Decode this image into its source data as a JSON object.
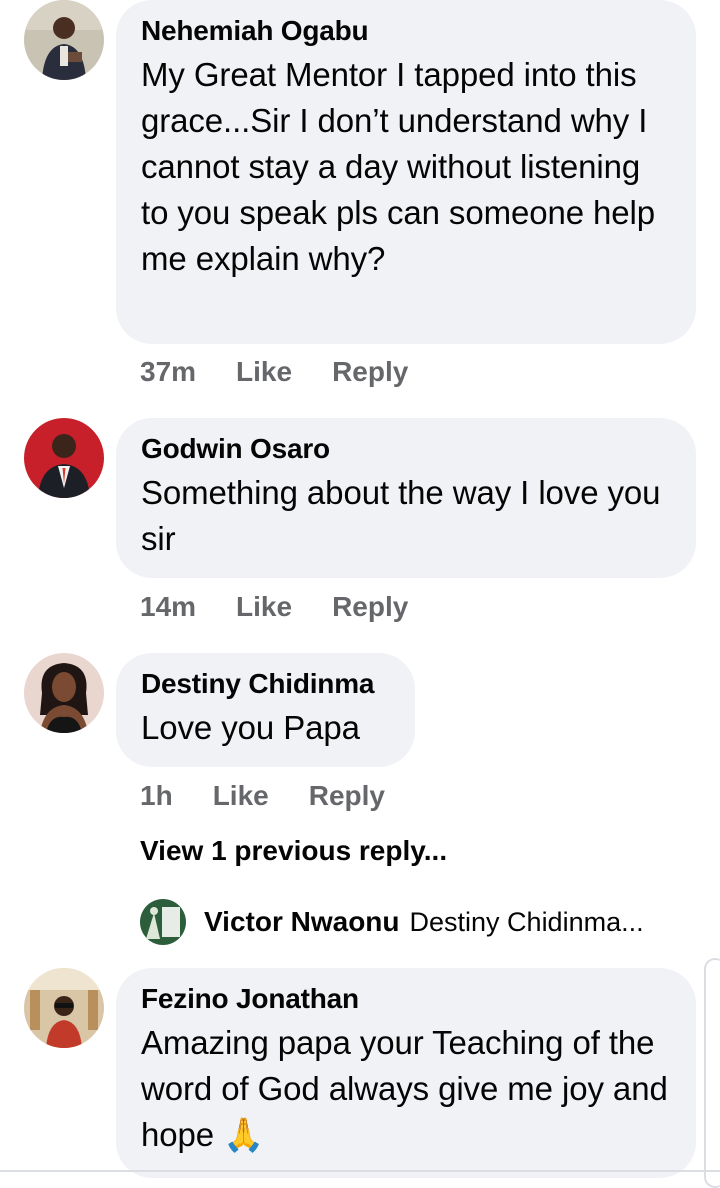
{
  "comments": [
    {
      "author": "Nehemiah Ogabu",
      "text": "My Great Mentor I tapped into this grace...Sir I don’t understand why I cannot stay a day without listening to you speak pls can someone help me explain why?",
      "time": "37m",
      "like": "Like",
      "reply": "Reply"
    },
    {
      "author": "Godwin Osaro",
      "text": "Something about the way I love you sir",
      "time": "14m",
      "like": "Like",
      "reply": "Reply"
    },
    {
      "author": "Destiny Chidinma",
      "text": "Love you Papa",
      "time": "1h",
      "like": "Like",
      "reply": "Reply",
      "view_previous": "View 1 previous reply...",
      "reply_preview": {
        "author": "Victor Nwaonu",
        "text": "Destiny Chidinma..."
      }
    },
    {
      "author": "Fezino Jonathan",
      "text": "Amazing papa your Teaching of the word of God always give me joy and hope",
      "emoji": "🙏"
    }
  ],
  "colors": {
    "bubble": "#f0f2f5",
    "meta": "#65676b",
    "text": "#050505"
  }
}
